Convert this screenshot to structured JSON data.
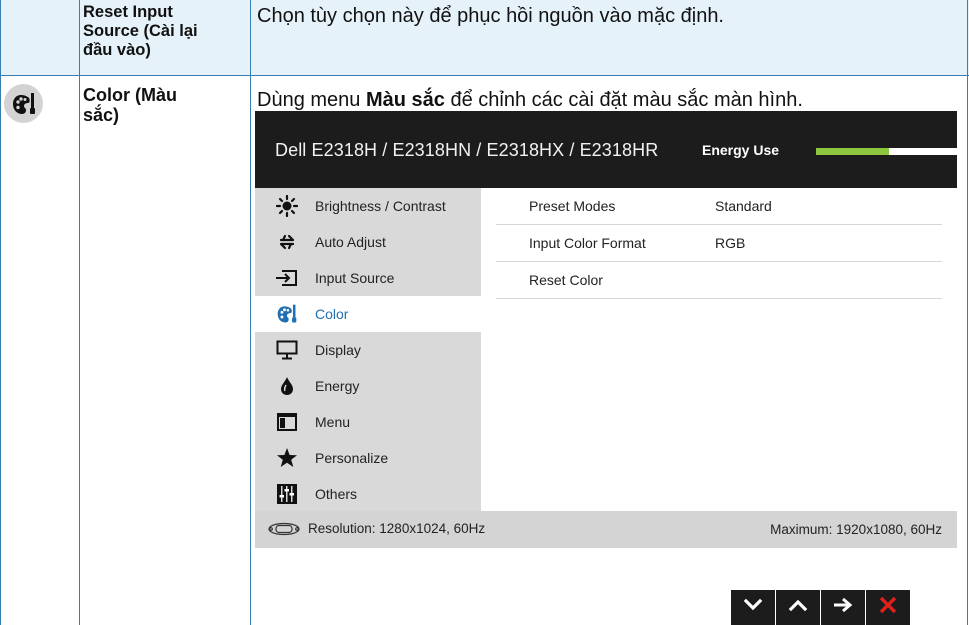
{
  "rows": [
    {
      "title": "Reset Input Source (Cài lại đầu vào)",
      "title_lines": [
        "Reset Input",
        "Source (Cài lại",
        "đầu vào)"
      ],
      "description": "Chọn tùy chọn này để phục hồi nguồn vào mặc định."
    },
    {
      "title_lines": [
        "Color (Màu",
        "sắc)"
      ],
      "description_pre": "Dùng menu ",
      "description_bold": "Màu sắc",
      "description_post": " để chỉnh các cài đặt màu sắc màn hình.",
      "icon": "color-palette-icon"
    }
  ],
  "osd": {
    "model_title": "Dell E2318H / E2318HN / E2318HX / E2318HR",
    "energy_label": "Energy Use",
    "energy_level": 0.52,
    "menu": [
      {
        "label": "Brightness / Contrast",
        "icon": "sun-icon",
        "active": false
      },
      {
        "label": "Auto Adjust",
        "icon": "auto-adjust-arrows-icon",
        "active": false
      },
      {
        "label": "Input Source",
        "icon": "input-source-icon",
        "active": false
      },
      {
        "label": "Color",
        "icon": "color-palette-icon",
        "active": true
      },
      {
        "label": "Display",
        "icon": "monitor-icon",
        "active": false
      },
      {
        "label": "Energy",
        "icon": "energy-drop-icon",
        "active": false
      },
      {
        "label": "Menu",
        "icon": "menu-window-icon",
        "active": false
      },
      {
        "label": "Personalize",
        "icon": "star-icon",
        "active": false
      },
      {
        "label": "Others",
        "icon": "sliders-icon",
        "active": false
      }
    ],
    "options": [
      {
        "name": "Preset Modes",
        "value": "Standard"
      },
      {
        "name": "Input Color Format",
        "value": "RGB"
      },
      {
        "name": "Reset Color",
        "value": ""
      }
    ],
    "resolution_text": "Resolution: 1280x1024, 60Hz",
    "maximum_text": "Maximum: 1920x1080, 60Hz",
    "nav_buttons": [
      {
        "name": "down",
        "icon": "chevron-down-icon"
      },
      {
        "name": "up",
        "icon": "chevron-up-icon"
      },
      {
        "name": "enter",
        "icon": "arrow-right-icon"
      },
      {
        "name": "exit",
        "icon": "close-icon"
      }
    ]
  },
  "colors": {
    "table_border": "#3a7db0",
    "row_highlight": "#e6f2fa",
    "osd_header": "#1c1c1c",
    "energy_fill": "#8dc63f",
    "menu_bg": "#d9d9d9",
    "active_label": "#1f6fb2",
    "exit_red": "#e0201b"
  }
}
